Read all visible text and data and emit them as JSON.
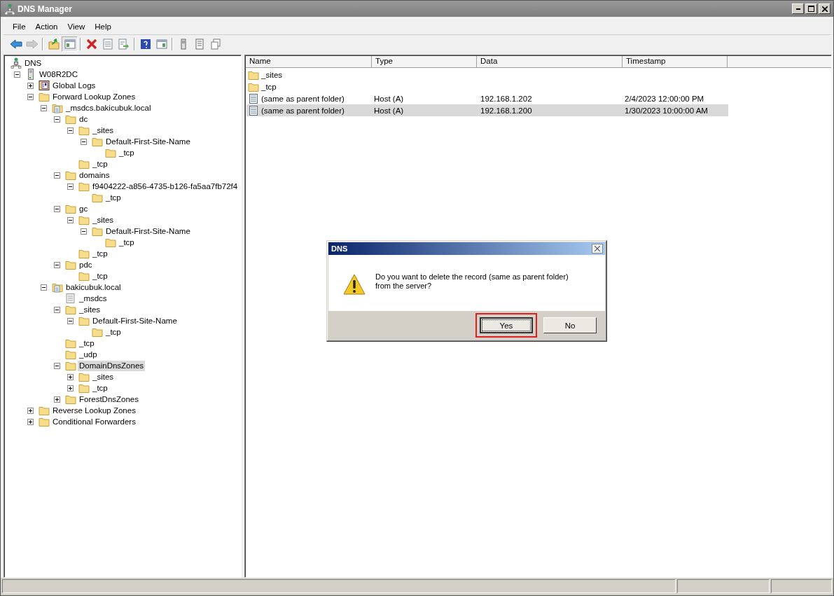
{
  "window": {
    "title": "DNS Manager"
  },
  "menu": [
    "File",
    "Action",
    "View",
    "Help"
  ],
  "toolbar": [
    {
      "kind": "back",
      "disabled": false,
      "pressed": false
    },
    {
      "kind": "forward",
      "disabled": true,
      "pressed": false
    },
    {
      "kind": "separator"
    },
    {
      "kind": "up",
      "disabled": false,
      "pressed": false
    },
    {
      "kind": "tree",
      "disabled": false,
      "pressed": true
    },
    {
      "kind": "separator"
    },
    {
      "kind": "delete",
      "disabled": false,
      "pressed": false
    },
    {
      "kind": "properties",
      "disabled": false,
      "pressed": false
    },
    {
      "kind": "export",
      "disabled": false,
      "pressed": false
    },
    {
      "kind": "separator"
    },
    {
      "kind": "help",
      "disabled": false,
      "pressed": false
    },
    {
      "kind": "actionpane",
      "disabled": false,
      "pressed": false
    },
    {
      "kind": "separator"
    },
    {
      "kind": "server",
      "disabled": false,
      "pressed": false
    },
    {
      "kind": "list",
      "disabled": false,
      "pressed": false
    },
    {
      "kind": "copy",
      "disabled": false,
      "pressed": false
    }
  ],
  "tree": {
    "label": "DNS",
    "kind": "dns",
    "selected": false,
    "children": [
      {
        "label": "W08R2DC",
        "kind": "server",
        "expanded": true,
        "selected": false,
        "children": [
          {
            "label": "Global Logs",
            "kind": "logs",
            "expanded": false,
            "selected": false
          },
          {
            "label": "Forward Lookup Zones",
            "kind": "folder",
            "expanded": true,
            "selected": false,
            "children": [
              {
                "label": "_msdcs.bakicubuk.local",
                "kind": "zone",
                "expanded": true,
                "selected": false,
                "children": [
                  {
                    "label": "dc",
                    "kind": "folder",
                    "expanded": true,
                    "selected": false,
                    "children": [
                      {
                        "label": "_sites",
                        "kind": "folder",
                        "expanded": true,
                        "selected": false,
                        "children": [
                          {
                            "label": "Default-First-Site-Name",
                            "kind": "folder",
                            "expanded": true,
                            "selected": false,
                            "children": [
                              {
                                "label": "_tcp",
                                "kind": "folder",
                                "selected": false
                              }
                            ]
                          }
                        ]
                      },
                      {
                        "label": "_tcp",
                        "kind": "folder",
                        "selected": false
                      }
                    ]
                  },
                  {
                    "label": "domains",
                    "kind": "folder",
                    "expanded": true,
                    "selected": false,
                    "children": [
                      {
                        "label": "f9404222-a856-4735-b126-fa5aa7fb72f4",
                        "kind": "folder",
                        "expanded": true,
                        "selected": false,
                        "children": [
                          {
                            "label": "_tcp",
                            "kind": "folder",
                            "selected": false
                          }
                        ]
                      }
                    ]
                  },
                  {
                    "label": "gc",
                    "kind": "folder",
                    "expanded": true,
                    "selected": false,
                    "children": [
                      {
                        "label": "_sites",
                        "kind": "folder",
                        "expanded": true,
                        "selected": false,
                        "children": [
                          {
                            "label": "Default-First-Site-Name",
                            "kind": "folder",
                            "expanded": true,
                            "selected": false,
                            "children": [
                              {
                                "label": "_tcp",
                                "kind": "folder",
                                "selected": false
                              }
                            ]
                          }
                        ]
                      },
                      {
                        "label": "_tcp",
                        "kind": "folder",
                        "selected": false
                      }
                    ]
                  },
                  {
                    "label": "pdc",
                    "kind": "folder",
                    "expanded": true,
                    "selected": false,
                    "children": [
                      {
                        "label": "_tcp",
                        "kind": "folder",
                        "selected": false
                      }
                    ]
                  }
                ]
              },
              {
                "label": "bakicubuk.local",
                "kind": "zone",
                "expanded": true,
                "selected": false,
                "children": [
                  {
                    "label": "_msdcs",
                    "kind": "delegation",
                    "selected": false
                  },
                  {
                    "label": "_sites",
                    "kind": "folder",
                    "expanded": true,
                    "selected": false,
                    "children": [
                      {
                        "label": "Default-First-Site-Name",
                        "kind": "folder",
                        "expanded": true,
                        "selected": false,
                        "children": [
                          {
                            "label": "_tcp",
                            "kind": "folder",
                            "selected": false
                          }
                        ]
                      }
                    ]
                  },
                  {
                    "label": "_tcp",
                    "kind": "folder",
                    "selected": false
                  },
                  {
                    "label": "_udp",
                    "kind": "folder",
                    "selected": false
                  },
                  {
                    "label": "DomainDnsZones",
                    "kind": "folder",
                    "expanded": true,
                    "selected": true,
                    "children": [
                      {
                        "label": "_sites",
                        "kind": "folder",
                        "expanded": false,
                        "selected": false
                      },
                      {
                        "label": "_tcp",
                        "kind": "folder",
                        "expanded": false,
                        "selected": false
                      }
                    ]
                  },
                  {
                    "label": "ForestDnsZones",
                    "kind": "folder",
                    "expanded": false,
                    "selected": false
                  }
                ]
              }
            ]
          },
          {
            "label": "Reverse Lookup Zones",
            "kind": "folder",
            "expanded": false,
            "selected": false
          },
          {
            "label": "Conditional Forwarders",
            "kind": "folder",
            "expanded": false,
            "selected": false
          }
        ]
      }
    ]
  },
  "list": {
    "columns": [
      "Name",
      "Type",
      "Data",
      "Timestamp"
    ],
    "rows": [
      {
        "kind": "folder",
        "name": "_sites",
        "selected": false
      },
      {
        "kind": "folder",
        "name": "_tcp",
        "selected": false
      },
      {
        "kind": "record",
        "name": "(same as parent folder)",
        "type": "Host (A)",
        "data": "192.168.1.202",
        "timestamp": "2/4/2023 12:00:00 PM",
        "selected": false
      },
      {
        "kind": "record",
        "name": "(same as parent folder)",
        "type": "Host (A)",
        "data": "192.168.1.200",
        "timestamp": "1/30/2023 10:00:00 AM",
        "selected": true
      }
    ]
  },
  "dialog": {
    "title": "DNS",
    "message": "Do you want to delete the record (same as parent folder) from the server?",
    "buttons": [
      {
        "label": "Yes",
        "focused": true,
        "highlighted": true
      },
      {
        "label": "No",
        "focused": false,
        "highlighted": false
      }
    ]
  }
}
